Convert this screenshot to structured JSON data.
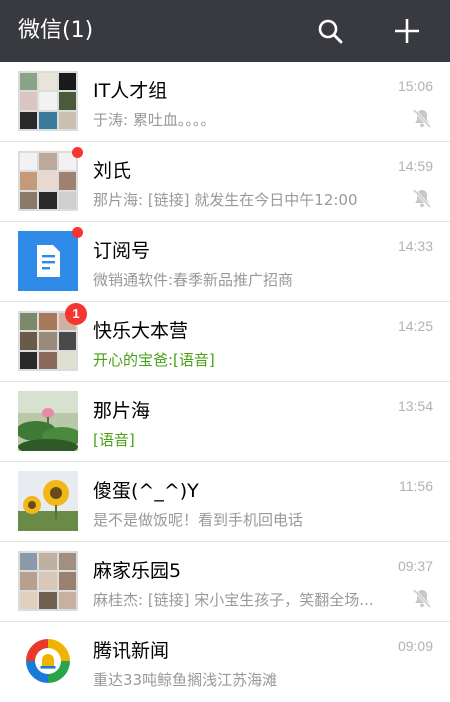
{
  "header": {
    "title": "微信(1)",
    "search_icon": "search-icon",
    "add_icon": "plus-icon",
    "background": "#393a3f"
  },
  "chats": [
    {
      "name": "IT人才组",
      "message": "于涛: 累吐血。。。。",
      "time": "15:06",
      "muted": true,
      "unread": null,
      "avatar": "group-grid"
    },
    {
      "name": "刘氏",
      "message": "那片海: [链接] 就发生在今日中午12:00",
      "time": "14:59",
      "muted": true,
      "unread": "dot",
      "avatar": "group-grid"
    },
    {
      "name": "订阅号",
      "message": "微销通软件:春季新品推广招商",
      "time": "14:33",
      "muted": false,
      "unread": "dot",
      "avatar": "subscription-icon"
    },
    {
      "name": "快乐大本营",
      "message": "开心的宝爸:[语音]",
      "time": "14:25",
      "muted": false,
      "unread": "1",
      "avatar": "group-grid",
      "message_color": "#4aa11a"
    },
    {
      "name": "那片海",
      "message": "[语音]",
      "time": "13:54",
      "muted": false,
      "unread": null,
      "avatar": "lotus-photo",
      "message_color": "#4aa11a"
    },
    {
      "name": "傻蛋(^_^)Y",
      "message": "是不是做饭呢！看到手机回电话",
      "time": "11:56",
      "muted": false,
      "unread": null,
      "avatar": "sunflower-photo"
    },
    {
      "name": "麻家乐园5",
      "message": "麻桂杰: [链接] 宋小宝生孩子，笑翻全场...",
      "time": "09:37",
      "muted": true,
      "unread": null,
      "avatar": "group-grid"
    },
    {
      "name": "腾讯新闻",
      "message": "重达33吨鲸鱼搁浅江苏海滩",
      "time": "09:09",
      "muted": false,
      "unread": null,
      "avatar": "tencent-news-logo"
    }
  ],
  "colors": {
    "unread_red": "#f43530",
    "green_text": "#4aa11a",
    "subscription_blue": "#2f8ae8"
  }
}
